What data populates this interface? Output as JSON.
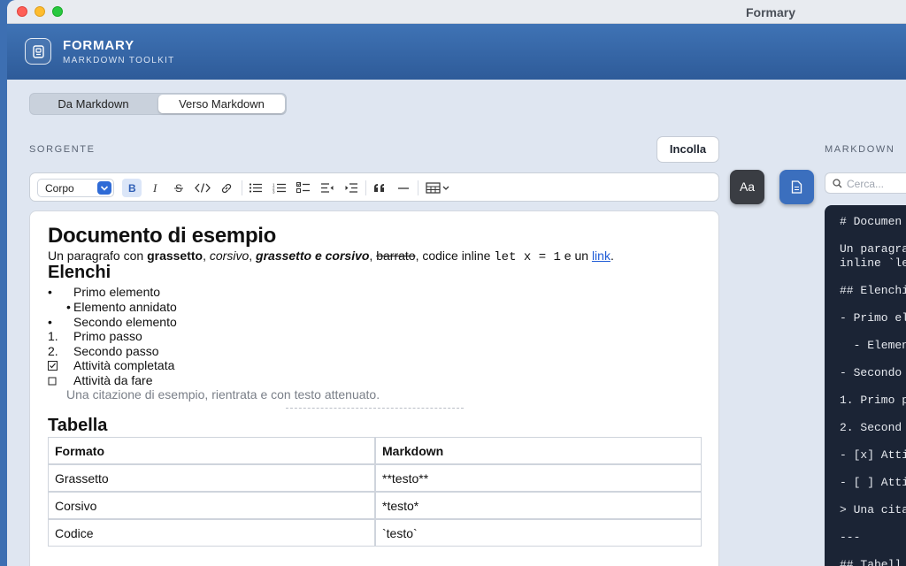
{
  "window": {
    "title": "Formary"
  },
  "app": {
    "name": "FORMARY",
    "subtitle": "MARKDOWN TOOLKIT"
  },
  "mode_tabs": [
    {
      "label": "Da Markdown",
      "selected": false
    },
    {
      "label": "Verso Markdown",
      "selected": true
    }
  ],
  "source": {
    "section_label": "SORGENTE",
    "paste_button": "Incolla"
  },
  "toolbar": {
    "paragraph_style": "Corpo",
    "buttons": [
      "bold",
      "italic",
      "strikethrough",
      "code",
      "link",
      "bullet-list",
      "numbered-list",
      "checklist",
      "outdent",
      "indent",
      "quote",
      "horizontal-rule",
      "table"
    ]
  },
  "side_buttons": {
    "font_button": "Aa",
    "document_icon": "document-icon"
  },
  "markdown": {
    "section_label": "MARKDOWN",
    "search_placeholder": "Cerca..."
  },
  "editor": {
    "title": "Documento di esempio",
    "paragraph": {
      "t1": "Un paragrafo con ",
      "bold": "grassetto",
      "t2": ", ",
      "italic": "corsivo",
      "t3": ", ",
      "bold_italic": "grassetto e corsivo",
      "t4": ", ",
      "strike": "barrato",
      "t5": ", codice inline ",
      "code": "let x = 1",
      "t6": " e un ",
      "link": "link",
      "t7": "."
    },
    "lists_heading": "Elenchi",
    "bullets": [
      {
        "marker": "•",
        "text": "Primo elemento"
      },
      {
        "marker": "•",
        "text": "Elemento annidato"
      },
      {
        "marker": "•",
        "text": "Secondo elemento"
      }
    ],
    "numbered": [
      {
        "marker": "1.",
        "text": "Primo passo"
      },
      {
        "marker": "2.",
        "text": "Secondo passo"
      }
    ],
    "tasks": [
      {
        "checked": true,
        "text": "Attività completata"
      },
      {
        "checked": false,
        "text": "Attività da fare"
      }
    ],
    "quote": "Una citazione di esempio, rientrata e con testo attenuato.",
    "table_heading": "Tabella",
    "table": {
      "headers": [
        "Formato",
        "Markdown"
      ],
      "rows": [
        [
          "Grassetto",
          "**testo**"
        ],
        [
          "Corsivo",
          "*testo*"
        ],
        [
          "Codice",
          "`testo`"
        ]
      ]
    }
  },
  "markdown_lines": [
    "# Documen",
    "Un paragra",
    "inline `le",
    "## Elenchi",
    "- Primo el",
    "  - Elemen",
    "- Secondo",
    "1. Primo p",
    "2. Second",
    "- [x] Atti",
    "- [ ] Atti",
    "> Una cita",
    "---",
    "## Tabell"
  ],
  "colors": {
    "header_blue": "#3f73b5",
    "link_blue": "#1e5bd6",
    "code_pane": "#1b2435",
    "active_button": "#dbe6f8"
  }
}
